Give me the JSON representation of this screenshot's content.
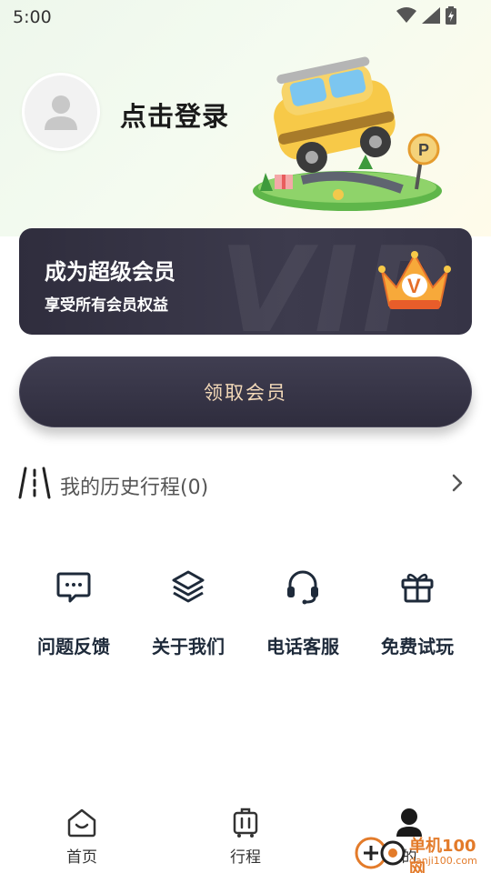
{
  "status_bar": {
    "time": "5:00"
  },
  "profile": {
    "login_label": "点击登录"
  },
  "vip": {
    "title": "成为超级会员",
    "subtitle": "享受所有会员权益",
    "watermark": "VIP",
    "badge": "V"
  },
  "claim_button": {
    "label": "领取会员"
  },
  "history": {
    "label": "我的历史行程(0)"
  },
  "features": [
    {
      "label": "问题反馈",
      "icon": "feedback-icon"
    },
    {
      "label": "关于我们",
      "icon": "layers-icon"
    },
    {
      "label": "电话客服",
      "icon": "headset-icon"
    },
    {
      "label": "免费试玩",
      "icon": "gift-icon"
    }
  ],
  "nav": {
    "items": [
      {
        "label": "首页",
        "icon": "home-icon"
      },
      {
        "label": "行程",
        "icon": "luggage-icon"
      },
      {
        "label": "的",
        "icon": "profile-icon"
      }
    ]
  },
  "watermark": {
    "text": "单机100网",
    "url_text": "danji100.com"
  },
  "colors": {
    "accent": "#f3d9b8",
    "card": "#36344a",
    "brand": "#e37b2a"
  }
}
